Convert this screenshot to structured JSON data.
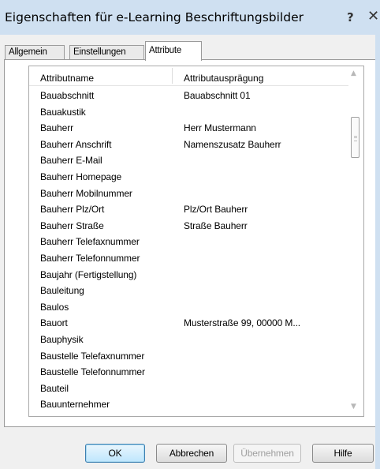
{
  "window": {
    "title": "Eigenschaften für e-Learning Beschriftungsbilder",
    "help_glyph": "?",
    "close_glyph": "✕"
  },
  "tabs": [
    {
      "label": "Allgemein",
      "active": false
    },
    {
      "label": "Einstellungen",
      "active": false
    },
    {
      "label": "Attribute",
      "active": true
    }
  ],
  "list": {
    "columns": [
      "Attributname",
      "Attributausprägung"
    ],
    "rows": [
      {
        "name": "Bauabschnitt",
        "value": "Bauabschnitt 01"
      },
      {
        "name": "Bauakustik",
        "value": ""
      },
      {
        "name": "Bauherr",
        "value": "Herr Mustermann"
      },
      {
        "name": "Bauherr Anschrift",
        "value": "Namenszusatz Bauherr"
      },
      {
        "name": "Bauherr E-Mail",
        "value": ""
      },
      {
        "name": "Bauherr Homepage",
        "value": ""
      },
      {
        "name": "Bauherr Mobilnummer",
        "value": ""
      },
      {
        "name": "Bauherr Plz/Ort",
        "value": "Plz/Ort Bauherr"
      },
      {
        "name": "Bauherr Straße",
        "value": "Straße Bauherr"
      },
      {
        "name": "Bauherr Telefaxnummer",
        "value": ""
      },
      {
        "name": "Bauherr Telefonnummer",
        "value": ""
      },
      {
        "name": "Baujahr (Fertigstellung)",
        "value": ""
      },
      {
        "name": "Bauleitung",
        "value": ""
      },
      {
        "name": "Baulos",
        "value": ""
      },
      {
        "name": "Bauort",
        "value": "Musterstraße 99, 00000 M..."
      },
      {
        "name": "Bauphysik",
        "value": ""
      },
      {
        "name": "Baustelle Telefaxnummer",
        "value": ""
      },
      {
        "name": "Baustelle Telefonnummer",
        "value": ""
      },
      {
        "name": "Bauteil",
        "value": ""
      },
      {
        "name": "Bauunternehmer",
        "value": ""
      }
    ],
    "scroll_up_glyph": "▲",
    "scroll_down_glyph": "▼"
  },
  "buttons": {
    "ok": "OK",
    "cancel": "Abbrechen",
    "apply": "Übernehmen",
    "help": "Hilfe"
  }
}
